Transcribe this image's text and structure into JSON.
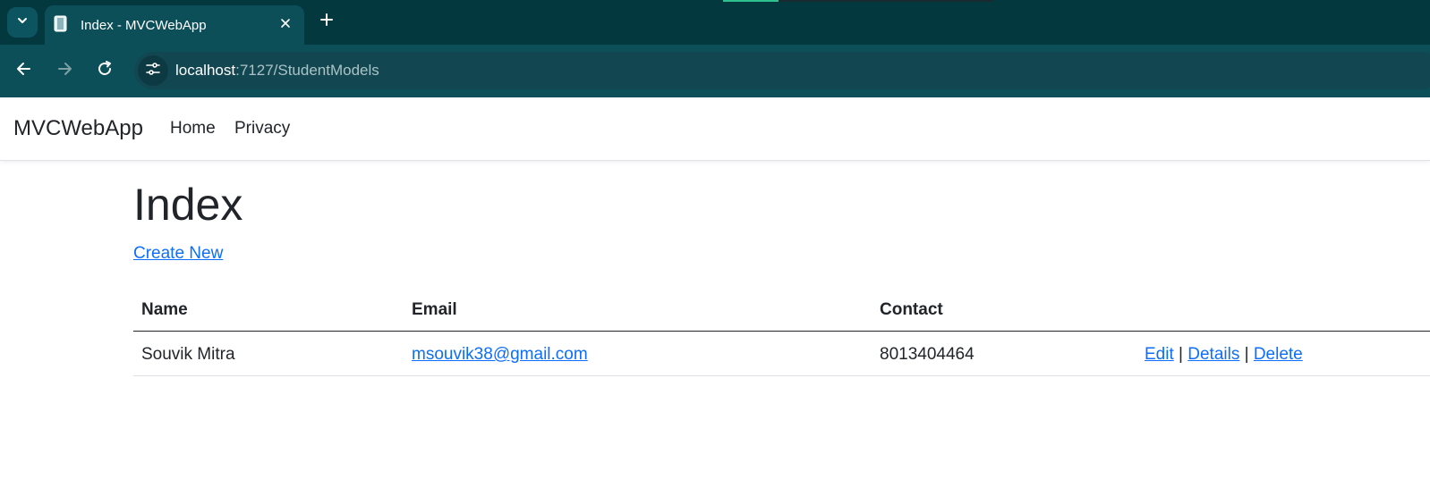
{
  "browser": {
    "tab_title": "Index - MVCWebApp",
    "url_host": "localhost",
    "url_path": ":7127/StudentModels",
    "icons": [
      "chevron-down-icon",
      "page-icon",
      "close-icon",
      "plus-icon",
      "back-arrow-icon",
      "forward-arrow-icon",
      "reload-icon",
      "site-settings-icon"
    ]
  },
  "site": {
    "brand": "MVCWebApp",
    "nav": {
      "home": "Home",
      "privacy": "Privacy"
    }
  },
  "main": {
    "title": "Index",
    "create_link": "Create New",
    "table": {
      "headers": {
        "name": "Name",
        "email": "Email",
        "contact": "Contact"
      },
      "rows": [
        {
          "name": "Souvik Mitra",
          "email": "msouvik38@gmail.com",
          "contact": "8013404464",
          "edit": "Edit",
          "details": "Details",
          "delete": "Delete",
          "separator": "|"
        }
      ]
    }
  },
  "colors": {
    "tab_strip": "#03383f",
    "toolbar": "#0d4f59",
    "link": "#0d6efd",
    "text": "#212529"
  }
}
